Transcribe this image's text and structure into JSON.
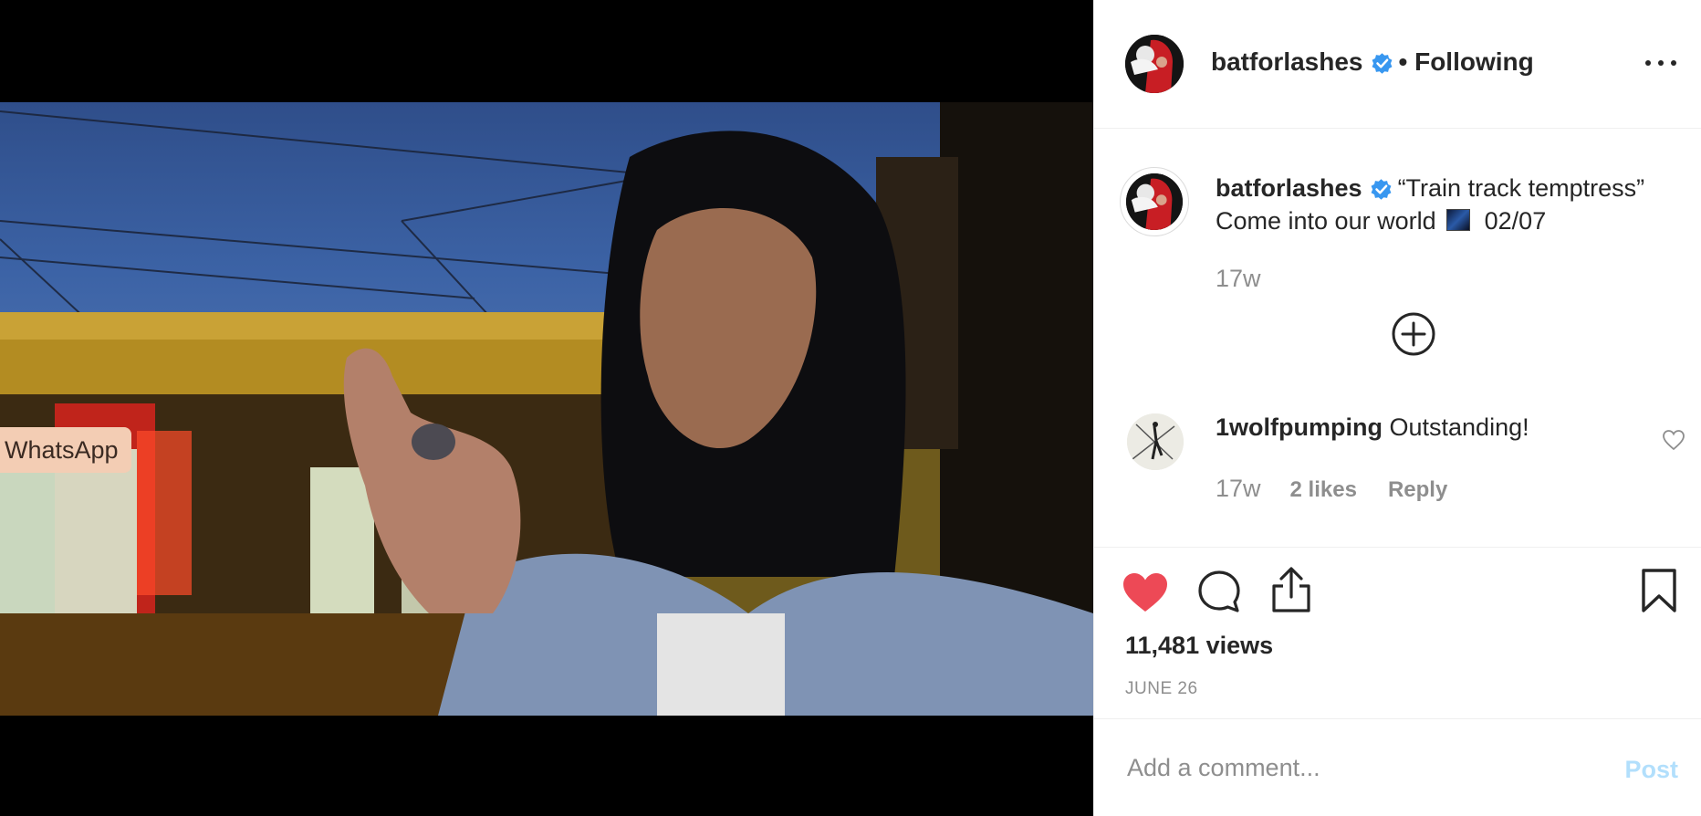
{
  "media": {
    "overlay_label": "WhatsApp"
  },
  "post": {
    "username": "batforlashes",
    "follow_status": "Following",
    "separator": "•",
    "more_icon": "more-horizontal-icon",
    "verified_icon": "verified-badge-icon"
  },
  "caption": {
    "username": "batforlashes",
    "text_line1": "“Train track temptress”",
    "text_line2_before": "Come into our world",
    "text_line2_after": "02/07",
    "time": "17w",
    "load_more_icon": "plus-circle-icon"
  },
  "comments": [
    {
      "username": "1wolfpumping",
      "text": "Outstanding!",
      "time": "17w",
      "likes": "2 likes",
      "reply_label": "Reply"
    }
  ],
  "actions": {
    "like_icon": "heart-filled-icon",
    "comment_icon": "comment-bubble-icon",
    "share_icon": "share-icon",
    "save_icon": "bookmark-icon",
    "views": "11,481 views",
    "date": "JUNE 26"
  },
  "add_comment": {
    "placeholder": "Add a comment...",
    "post_label": "Post"
  },
  "colors": {
    "like_red": "#ed4956",
    "verified_blue": "#3897f0",
    "post_disabled": "#b2dffc",
    "secondary_text": "#8e8e8e"
  }
}
